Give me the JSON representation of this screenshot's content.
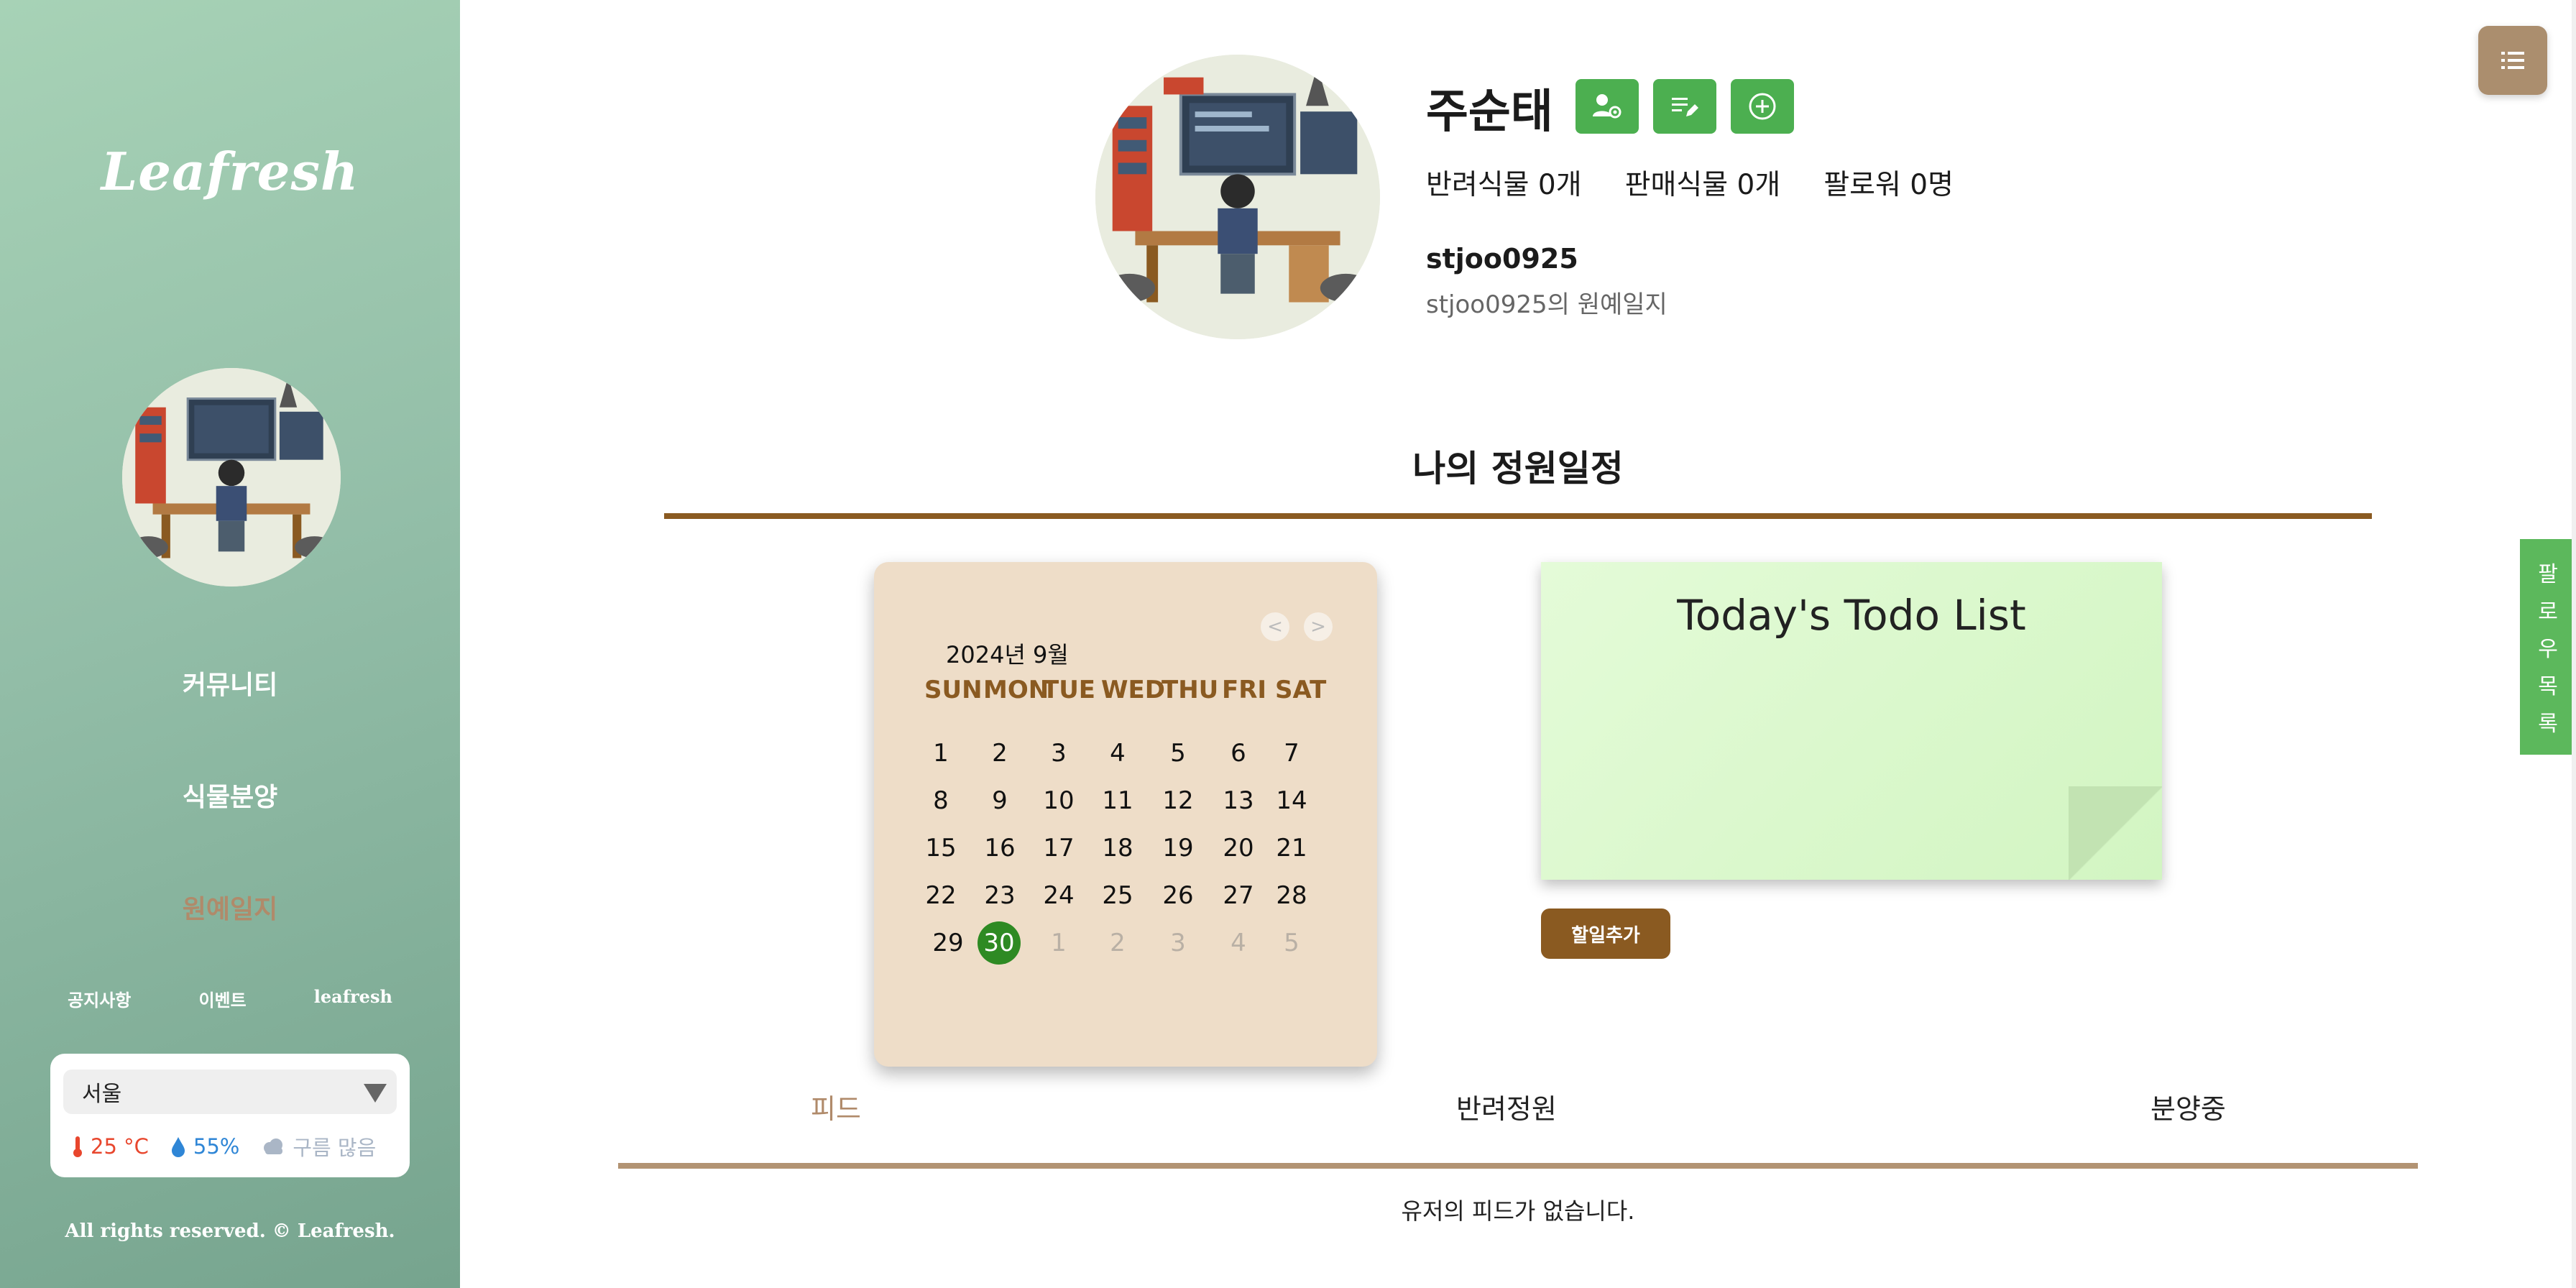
{
  "sidebar": {
    "logo": "Leafresh",
    "nav": [
      {
        "label": "커뮤니티"
      },
      {
        "label": "식물분양"
      },
      {
        "label": "원예일지"
      }
    ],
    "links": [
      "공지사항",
      "이벤트",
      "leafresh"
    ],
    "weather": {
      "city": "서울",
      "temperature": "25 °C",
      "humidity": "55%",
      "condition": "구름 많음"
    },
    "copyright": "All rights reserved. © Leafresh."
  },
  "profile": {
    "name": "주순태",
    "stats": [
      "반려식물 0개",
      "판매식물 0개",
      "팔로워 0명"
    ],
    "username": "stjoo0925",
    "subtitle": "stjoo0925의 원예일지"
  },
  "schedule": {
    "title": "나의 정원일정"
  },
  "calendar": {
    "month_label": "2024년 9월",
    "weekdays": [
      "SUN",
      "MON",
      "TUE",
      "WED",
      "THU",
      "FRI",
      "SAT"
    ],
    "weeks": [
      [
        "1",
        "2",
        "3",
        "4",
        "5",
        "6",
        "7"
      ],
      [
        "8",
        "9",
        "10",
        "11",
        "12",
        "13",
        "14"
      ],
      [
        "15",
        "16",
        "17",
        "18",
        "19",
        "20",
        "21"
      ],
      [
        "22",
        "23",
        "24",
        "25",
        "26",
        "27",
        "28"
      ],
      [
        "29",
        "30",
        "1",
        "2",
        "3",
        "4",
        "5"
      ]
    ],
    "today": "30",
    "prev": "<",
    "next": ">"
  },
  "todo": {
    "title": "Today's Todo List",
    "add_button": "할일추가"
  },
  "tabs": [
    "피드",
    "반려정원",
    "분양중"
  ],
  "feed": {
    "empty_message": "유저의 피드가 없습니다."
  },
  "follow_list_label": [
    "팔",
    "로",
    "우",
    "목",
    "록"
  ],
  "colors": {
    "accent_green": "#4caf50",
    "brown": "#8a5a21",
    "today_green": "#2e8a23"
  }
}
